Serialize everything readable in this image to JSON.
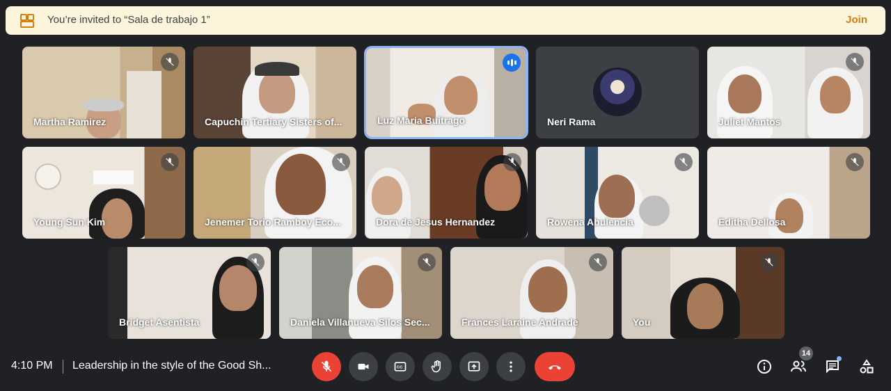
{
  "banner": {
    "text": "You’re invited to “Sala de trabajo 1”",
    "join_label": "Join",
    "icon": "breakout-rooms-icon",
    "accent": "#d37f0f"
  },
  "participants": [
    {
      "name": "Martha Ramirez",
      "muted": true
    },
    {
      "name": "Capuchin Tertiary Sisters of...",
      "muted": false
    },
    {
      "name": "Luz Maria Buitrago",
      "speaking": true
    },
    {
      "name": "Neri Rama",
      "muted": false,
      "avatar": true
    },
    {
      "name": "Juliet Mantos",
      "muted": true
    },
    {
      "name": "Young Sun Kim",
      "muted": true
    },
    {
      "name": "Jenemer Torio Ramboy Eco...",
      "muted": true
    },
    {
      "name": "Dora de Jesus Hernandez",
      "muted": true
    },
    {
      "name": "Rowena Abulencia",
      "muted": true
    },
    {
      "name": "Editha Dellosa",
      "muted": true
    },
    {
      "name": "Bridget Asentista",
      "muted": true
    },
    {
      "name": "Daniela Villanueva Silos Sec...",
      "muted": true
    },
    {
      "name": "Frances Laraine Andrade",
      "muted": true
    },
    {
      "name": "You",
      "muted": true
    }
  ],
  "bottombar": {
    "time": "4:10 PM",
    "meeting_title": "Leadership in the style of the Good Sh...",
    "participant_count": "14",
    "end_color": "#ea4335",
    "icons": [
      "mic-off-icon",
      "camera-icon",
      "captions-icon",
      "raise-hand-icon",
      "present-icon",
      "more-options-icon",
      "end-call-icon",
      "info-icon",
      "people-icon",
      "chat-icon",
      "activities-icon"
    ]
  }
}
